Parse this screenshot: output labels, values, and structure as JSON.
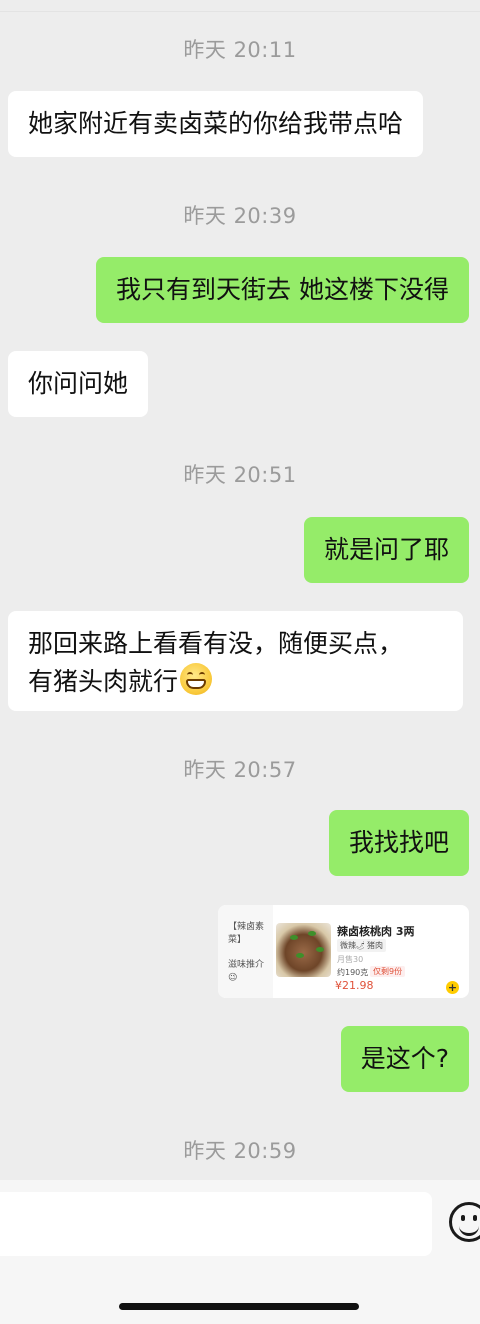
{
  "messages": [
    {
      "type": "time",
      "text": "昨天 20:11"
    },
    {
      "type": "in",
      "text": "她家附近有卖卤菜的你给我带点哈"
    },
    {
      "type": "time",
      "text": "昨天 20:39"
    },
    {
      "type": "out",
      "text": "我只有到天街去 她这楼下没得"
    },
    {
      "type": "in",
      "text": "你问问她"
    },
    {
      "type": "time",
      "text": "昨天 20:51"
    },
    {
      "type": "out",
      "text": "就是问了耶"
    },
    {
      "type": "in",
      "line1": "那回来路上看看有没，随便买点，",
      "line2": "有猪头肉就行",
      "emoji": "grinning-face"
    },
    {
      "type": "time",
      "text": "昨天 20:57"
    },
    {
      "type": "out",
      "text": "我找找吧"
    },
    {
      "type": "out",
      "text": "是这个?"
    },
    {
      "type": "time",
      "text": "昨天 20:59"
    }
  ],
  "shared_card": {
    "side_items": [
      "【辣卤素菜】",
      "滋味推介😉"
    ],
    "title": "辣卤核桃肉 3两",
    "tags": [
      "微辣🌶",
      "猪肉"
    ],
    "sold": "月售30",
    "weight": "约190克",
    "left": "仅剩9份",
    "price": "¥21.98",
    "add": "+"
  },
  "input_bar": {
    "placeholder": "",
    "emoji_icon": "smiley-face-icon"
  }
}
